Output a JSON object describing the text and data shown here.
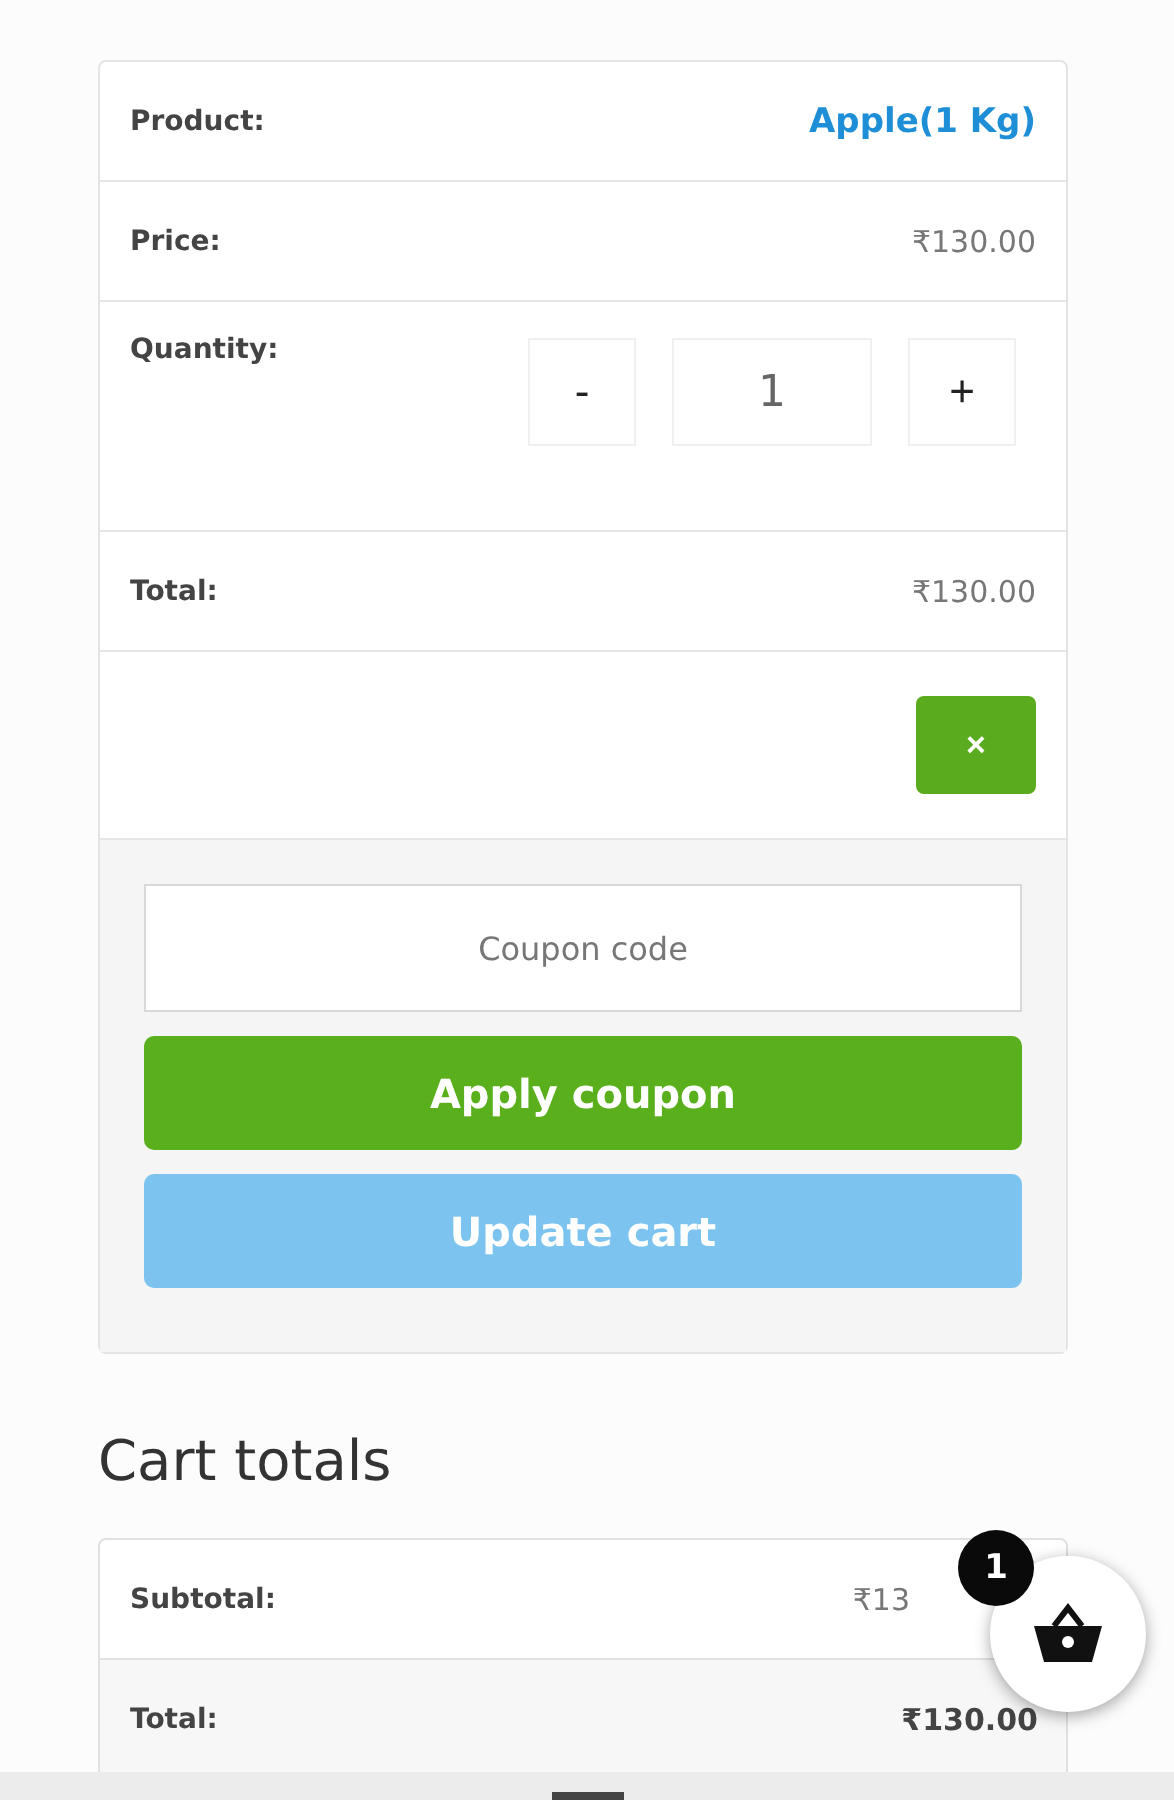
{
  "cart_item": {
    "rows": [
      {
        "kind": "link",
        "label": "Product:",
        "value": "Apple(1 Kg)"
      },
      {
        "kind": "price",
        "label": "Price:",
        "value": "₹130.00"
      },
      {
        "kind": "quantity",
        "label": "Quantity:",
        "minus": "-",
        "value": "1",
        "plus": "+"
      },
      {
        "kind": "price",
        "label": "Total:",
        "value": "₹130.00"
      },
      {
        "kind": "remove",
        "value": "×"
      }
    ]
  },
  "coupon": {
    "placeholder": "Coupon code",
    "apply": "Apply coupon",
    "update": "Update cart",
    "update_disabled": true
  },
  "cart_totals": {
    "title": "Cart totals",
    "rows": [
      {
        "label": "Subtotal:",
        "value": "₹13",
        "bold": false
      },
      {
        "label": "Total:",
        "value": "₹130.00",
        "bold": true
      }
    ]
  },
  "cart_badge": {
    "count": "1"
  }
}
